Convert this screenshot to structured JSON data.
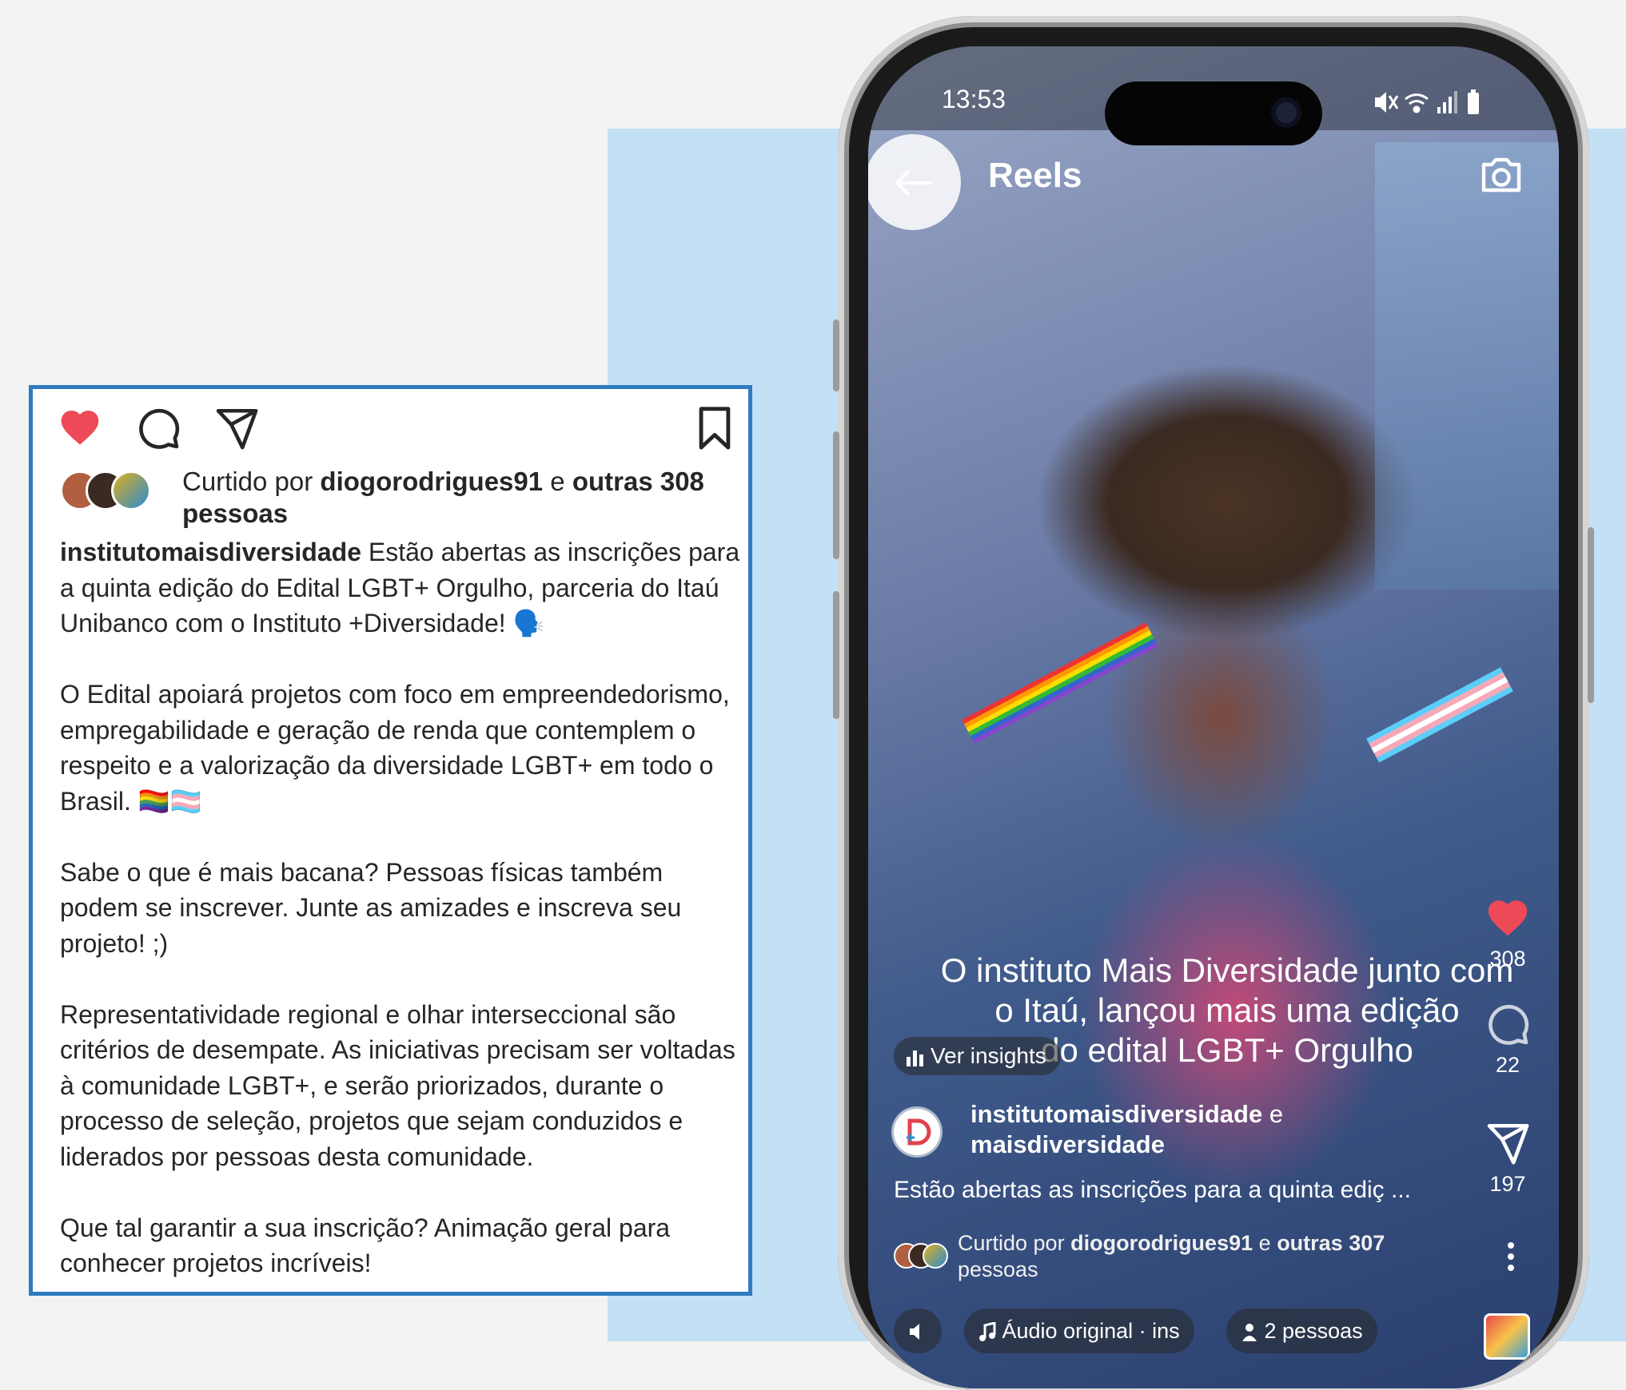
{
  "post": {
    "liked_by_prefix": "Curtido por",
    "liked_by_user": "diogorodrigues91",
    "liked_by_mid": "e",
    "liked_by_others": "outras 308",
    "liked_by_suffix": "pessoas",
    "caption_user": "institutomaisdiversidade",
    "caption_p1": "Estão abertas as inscrições para a quinta edição do Edital LGBT+ Orgulho, parceria do Itaú Unibanco com o Instituto +Diversidade! 🗣️",
    "caption_p2": "O Edital apoiará projetos com foco em empreendedorismo, empregabilidade e geração de renda que contemplem o respeito e a valorização da diversidade LGBT+ em todo o Brasil. 🏳️‍🌈🏳️‍⚧️",
    "caption_p3": "Sabe o que é mais bacana? Pessoas físicas também podem se inscrever. Junte as amizades e inscreva seu projeto! ;)",
    "caption_p4": "Representatividade regional e olhar interseccional são critérios de desempate. As iniciativas precisam ser voltadas à comunidade LGBT+, e serão priorizados, durante o processo de seleção, projetos que sejam conduzidos e liderados por pessoas desta comunidade.",
    "caption_p5": "Que tal garantir a sua inscrição? Animação geral para conhecer projetos incríveis!",
    "icons": [
      "heart-filled-icon",
      "comment-icon",
      "share-icon",
      "bookmark-icon"
    ],
    "colors": {
      "border": "#2f7bbf",
      "like": "#ed4956"
    }
  },
  "phone": {
    "time": "13:53",
    "title": "Reels",
    "subtitle_lines": [
      "O instituto Mais Diversidade junto com",
      "o Itaú, lançou mais uma edição",
      "do edital LGBT+ Orgulho"
    ],
    "insights_label": "Ver insights",
    "likes_count": "308",
    "comments_count": "22",
    "shares_count": "197",
    "author_user": "institutomaisdiversidade",
    "author_joiner": "e",
    "author_coauthor": "maisdiversidade",
    "caption_preview": "Estão abertas as inscrições para a quinta ediç ...",
    "liked_prefix": "Curtido por",
    "liked_user": "diogorodrigues91",
    "liked_mid": "e",
    "liked_others": "outras 307",
    "liked_suffix": "pessoas",
    "audio_label": "Áudio original · ins",
    "people_label": "2 pessoas",
    "status_icons": [
      "mute-icon",
      "wifi-icon",
      "signal-icon",
      "battery-icon"
    ],
    "colors": {
      "background_panel": "#c3e0f5",
      "like": "#ed4956"
    }
  }
}
